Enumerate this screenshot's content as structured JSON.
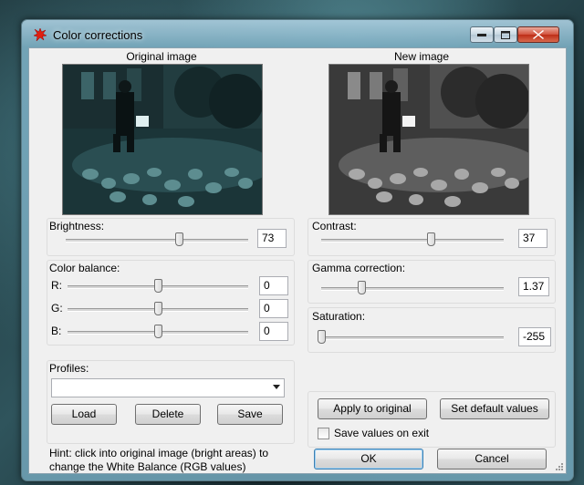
{
  "window": {
    "title": "Color corrections"
  },
  "images": {
    "original_caption": "Original image",
    "new_caption": "New image"
  },
  "brightness": {
    "label": "Brightness:",
    "value": "73",
    "level": 0.62
  },
  "contrast": {
    "label": "Contrast:",
    "value": "37",
    "level": 0.6
  },
  "color_balance": {
    "label": "Color balance:",
    "channels": [
      {
        "label": "R:",
        "value": "0",
        "level": 0.5
      },
      {
        "label": "G:",
        "value": "0",
        "level": 0.5
      },
      {
        "label": "B:",
        "value": "0",
        "level": 0.5
      }
    ]
  },
  "gamma": {
    "label": "Gamma correction:",
    "value": "1.37",
    "level": 0.22
  },
  "saturation": {
    "label": "Saturation:",
    "value": "-255",
    "level": 0.0
  },
  "profiles": {
    "label": "Profiles:",
    "selected": "",
    "load_label": "Load",
    "delete_label": "Delete",
    "save_label": "Save"
  },
  "actions": {
    "apply_label": "Apply to original",
    "defaults_label": "Set default values",
    "save_on_exit_label": "Save values on exit",
    "save_on_exit_checked": false,
    "ok_label": "OK",
    "cancel_label": "Cancel"
  },
  "hint": {
    "line1": "Hint: click into original image (bright areas) to",
    "line2": "change the White Balance (RGB values)"
  },
  "icons": {
    "app": "color-splash-icon",
    "minimize": "minimize-icon",
    "maximize": "maximize-icon",
    "close": "close-icon"
  }
}
